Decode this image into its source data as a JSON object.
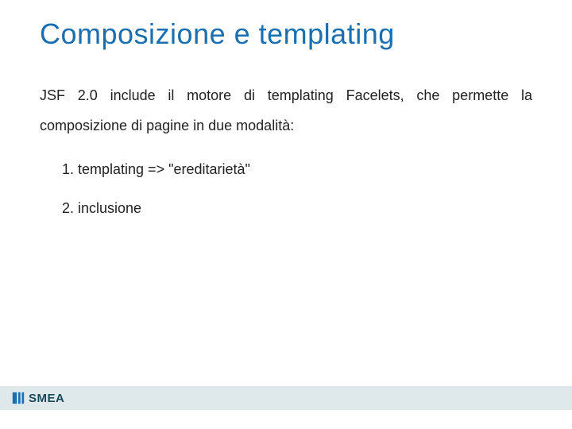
{
  "title": "Composizione e templating",
  "intro": "JSF 2.0 include il motore di templating Facelets, che permette la composizione di pagine in due modalità:",
  "list": {
    "item1": "1. templating => \"ereditarietà\"",
    "item2": "2. inclusione"
  },
  "footer": {
    "brand": "SMEA"
  }
}
